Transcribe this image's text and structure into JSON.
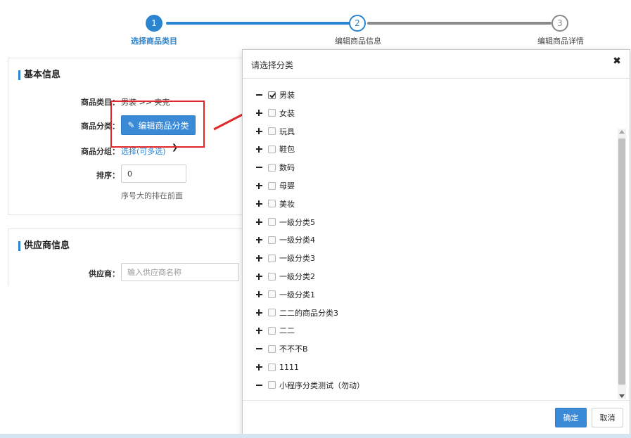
{
  "stepper": {
    "steps": [
      {
        "number": "1",
        "label": "选择商品类目",
        "state": "done"
      },
      {
        "number": "2",
        "label": "编辑商品信息",
        "state": "active"
      },
      {
        "number": "3",
        "label": "编辑商品详情",
        "state": "todo"
      }
    ]
  },
  "basic_info": {
    "title": "基本信息",
    "category_label": "商品类目：",
    "category_value": "男装 >> 夹克",
    "classify_label": "商品分类：",
    "edit_classify_button": "编辑商品分类",
    "group_label": "商品分组：",
    "group_link": "选择(可多选)",
    "sort_label": "排序：",
    "sort_value": "0",
    "sort_hint": "序号大的排在前面"
  },
  "supplier_info": {
    "title": "供应商信息",
    "supplier_label": "供应商：",
    "supplier_placeholder": "输入供应商名称"
  },
  "modal": {
    "title": "请选择分类",
    "close_glyph": "✖",
    "confirm_button": "确定",
    "cancel_button": "取消",
    "tree": [
      {
        "label": "男装",
        "toggle": "minus",
        "checked": true
      },
      {
        "label": "女装",
        "toggle": "plus",
        "checked": false
      },
      {
        "label": "玩具",
        "toggle": "plus",
        "checked": false
      },
      {
        "label": "鞋包",
        "toggle": "plus",
        "checked": false
      },
      {
        "label": "数码",
        "toggle": "minus",
        "checked": false
      },
      {
        "label": "母婴",
        "toggle": "plus",
        "checked": false
      },
      {
        "label": "美妆",
        "toggle": "plus",
        "checked": false
      },
      {
        "label": "一级分类5",
        "toggle": "plus",
        "checked": false
      },
      {
        "label": "一级分类4",
        "toggle": "plus",
        "checked": false
      },
      {
        "label": "一级分类3",
        "toggle": "plus",
        "checked": false
      },
      {
        "label": "一级分类2",
        "toggle": "plus",
        "checked": false
      },
      {
        "label": "一级分类1",
        "toggle": "plus",
        "checked": false
      },
      {
        "label": "二二的商品分类3",
        "toggle": "plus",
        "checked": false
      },
      {
        "label": "二二",
        "toggle": "plus",
        "checked": false
      },
      {
        "label": "不不不B",
        "toggle": "minus",
        "checked": false
      },
      {
        "label": "1111",
        "toggle": "plus",
        "checked": false
      },
      {
        "label": "小程序分类测试（勿动）",
        "toggle": "minus",
        "checked": false
      }
    ]
  },
  "colors": {
    "accent": "#2a84d0",
    "highlight": "#e0282a",
    "inactive": "#8a8a8a"
  }
}
